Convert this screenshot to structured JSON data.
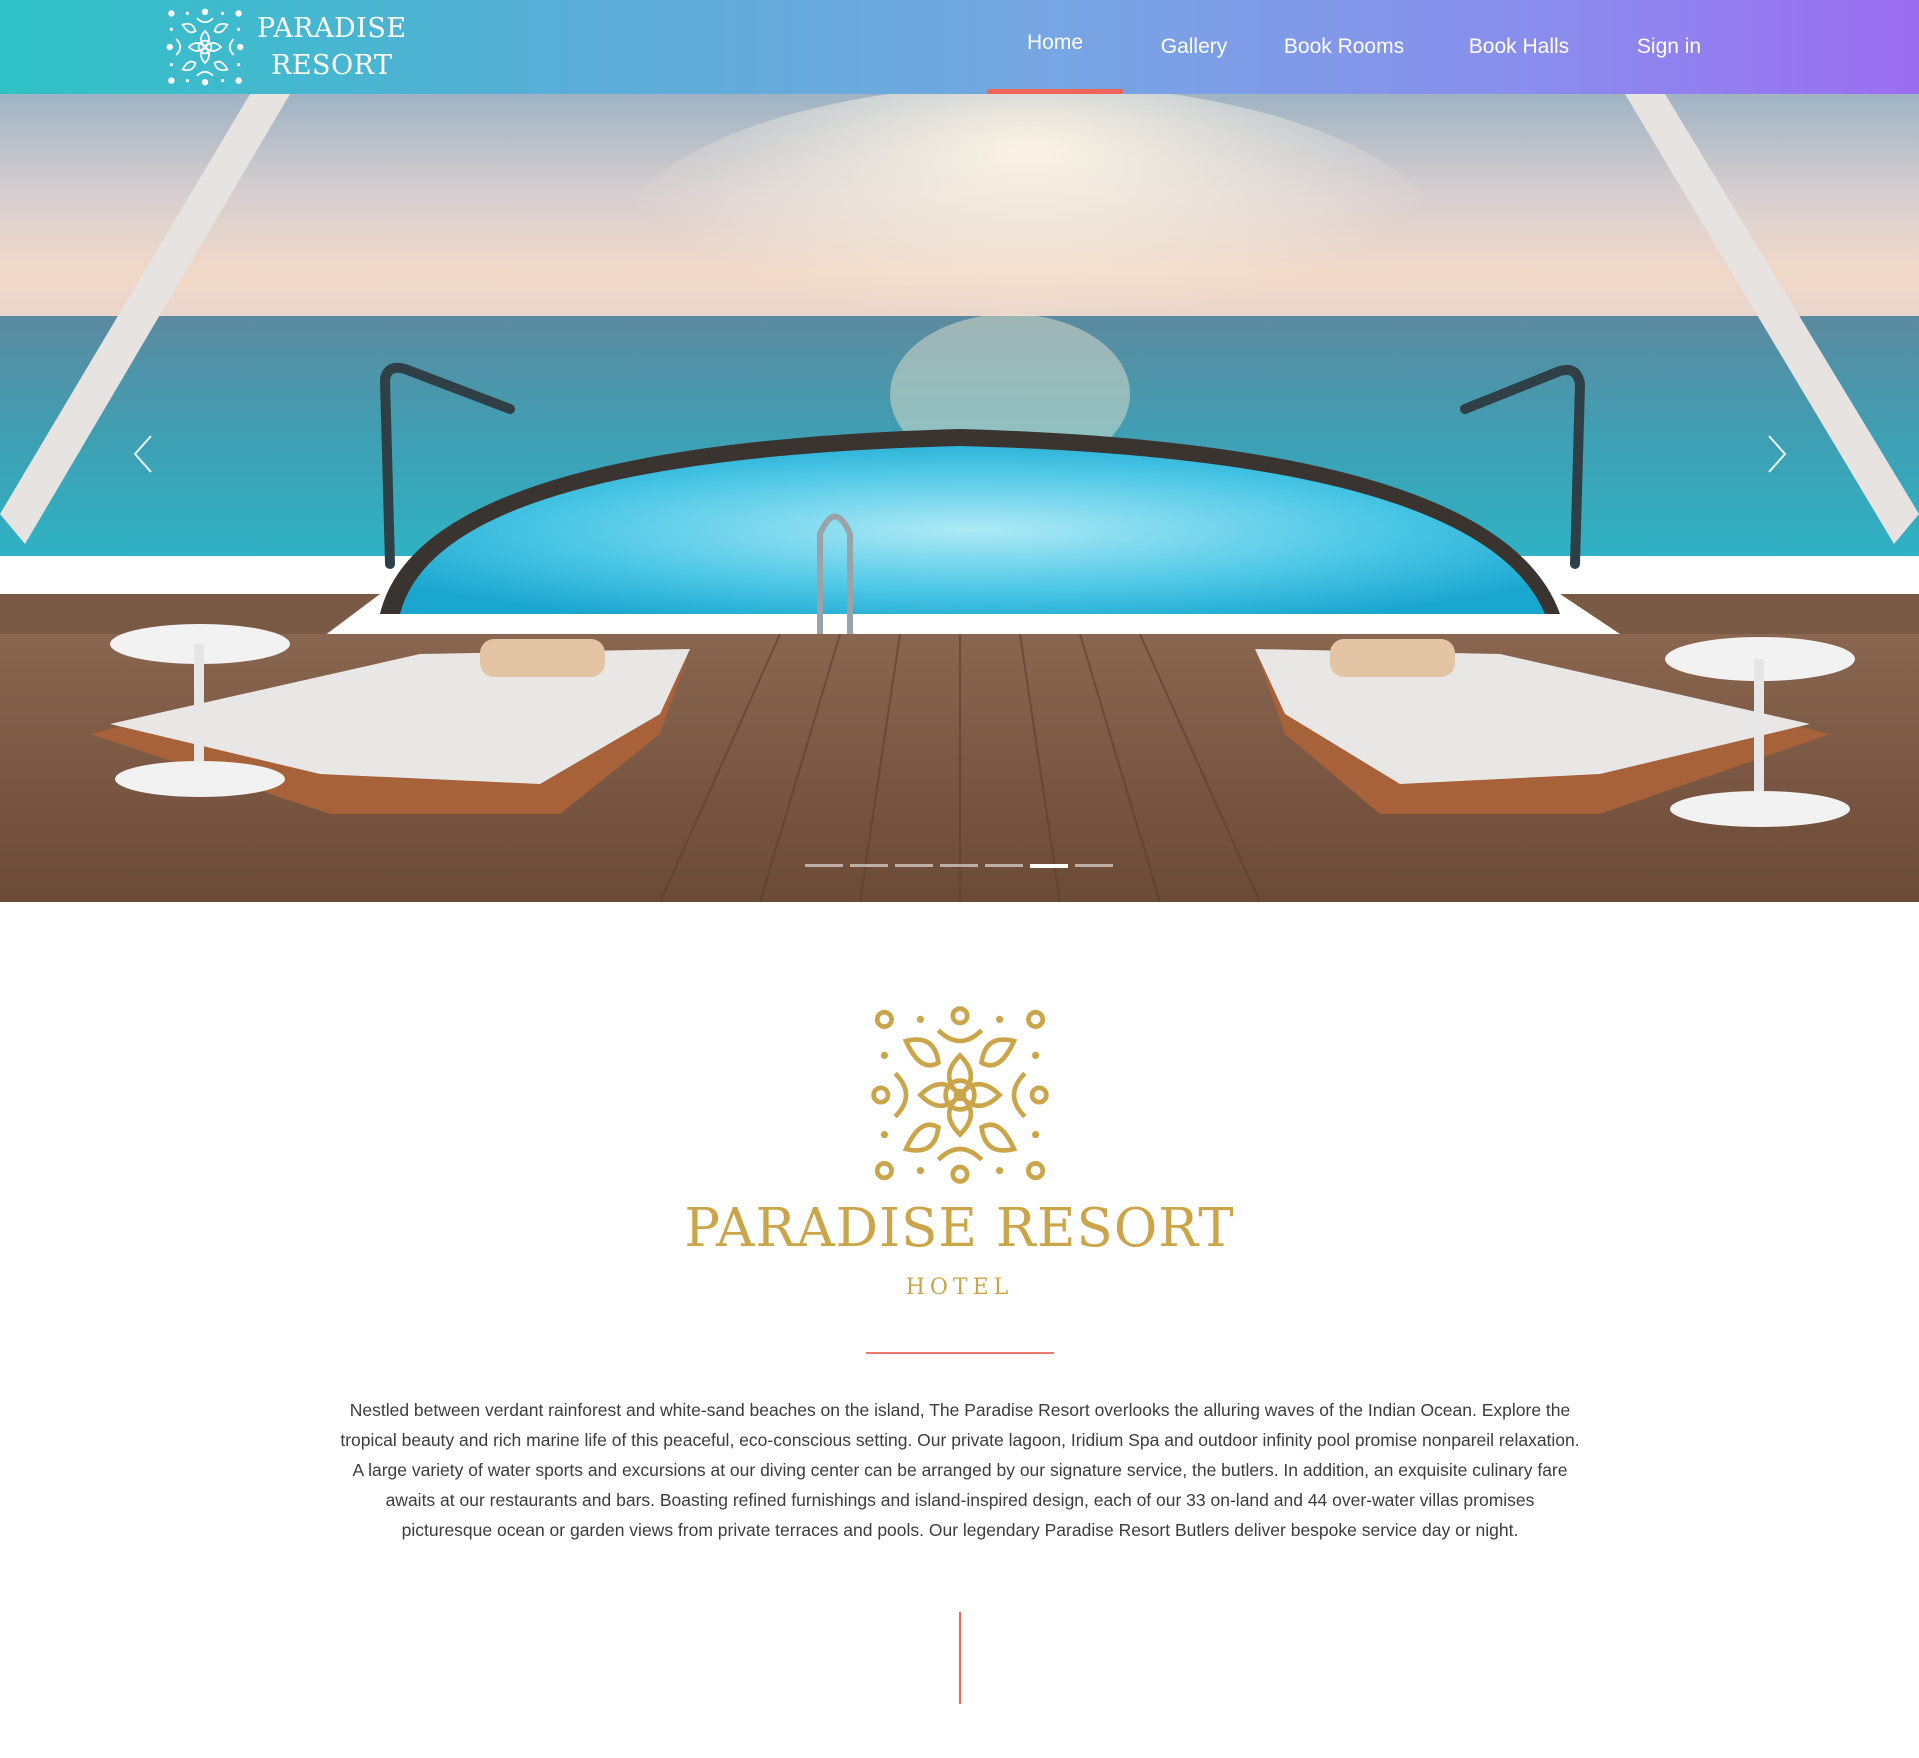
{
  "brand": {
    "name_line1": "PARADISE",
    "name_line2": "RESORT",
    "logo_icon": "ornament-logo-icon",
    "logo_color": "#ffffff"
  },
  "nav": {
    "items": [
      {
        "label": "Home",
        "active": true
      },
      {
        "label": "Gallery",
        "active": false
      },
      {
        "label": "Book Rooms",
        "active": false
      },
      {
        "label": "Book Halls",
        "active": false
      },
      {
        "label": "Sign in",
        "active": false
      }
    ],
    "gradient_start": "#2ec2c6",
    "gradient_end": "#9b6df1",
    "active_underline_color": "#f0645a"
  },
  "carousel": {
    "prev_icon": "chevron-left-icon",
    "next_icon": "chevron-right-icon",
    "slide_count": 7,
    "active_slide": 6
  },
  "intro": {
    "logo_icon": "ornament-logo-icon",
    "logo_color": "#cba54a",
    "title": "PARADISE RESORT",
    "subtitle": "HOTEL",
    "accent_color": "#f0645a",
    "body": "Nestled between verdant rainforest and white-sand beaches on the island, The Paradise Resort overlooks the alluring waves of the Indian Ocean. Explore the tropical beauty and rich marine life of this peaceful, eco-conscious setting. Our private lagoon, Iridium Spa and outdoor infinity pool promise nonpareil relaxation. A large variety of water sports and excursions at our diving center can be arranged by our signature service, the butlers. In addition, an exquisite culinary fare awaits at our restaurants and bars. Boasting refined furnishings and island-inspired design, each of our 33 on-land and 44 over-water villas promises picturesque ocean or garden views from private terraces and pools. Our legendary Paradise Resort Butlers deliver bespoke service day or night."
  }
}
